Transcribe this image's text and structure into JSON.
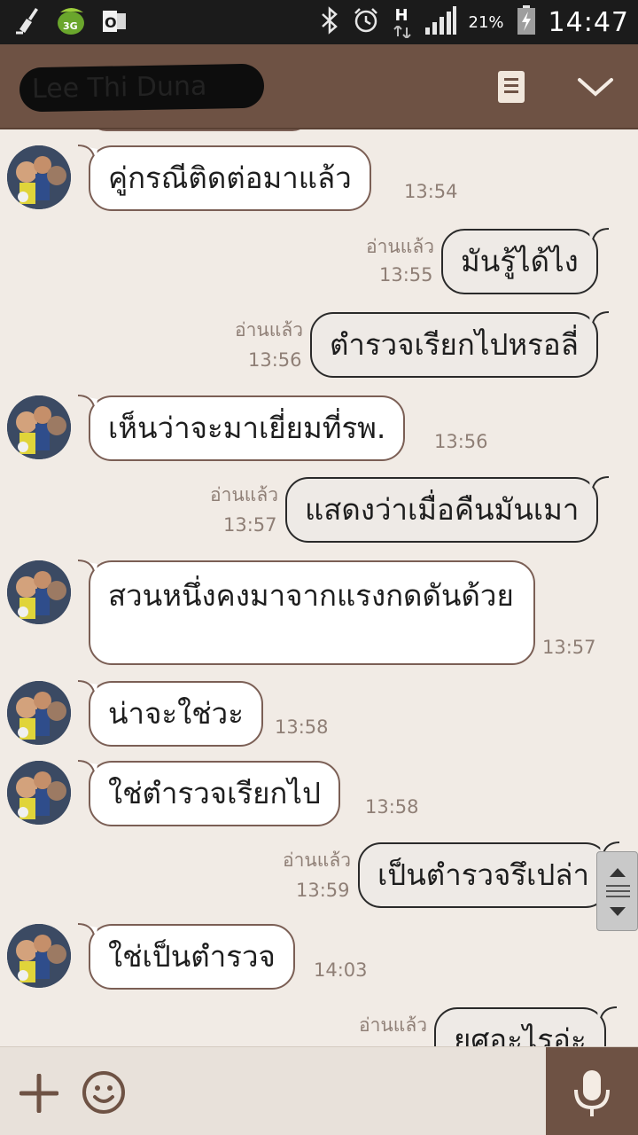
{
  "status_bar": {
    "battery_text": "21%",
    "clock": "14:47",
    "network_label": "H",
    "icons": [
      "broom-icon",
      "3g-leaf-icon",
      "outlook-icon",
      "bluetooth-icon",
      "alarm-icon",
      "signal-icon",
      "battery-icon"
    ]
  },
  "header": {
    "title": "Lee Thi Duna",
    "icons": [
      "memo-icon",
      "chevron-down-icon"
    ],
    "color": "#6e5244"
  },
  "messages": [
    {
      "dir": "in",
      "text": "คู่กรณีติดต่อมาแล้ว",
      "time": "13:54"
    },
    {
      "dir": "out",
      "text": "มันรู้ได้ไง",
      "read": "อ่านแล้ว",
      "time": "13:55"
    },
    {
      "dir": "out",
      "text": "ตำรวจเรียกไปหรอลี่",
      "read": "อ่านแล้ว",
      "time": "13:56"
    },
    {
      "dir": "in",
      "text": "เห็นว่าจะมาเยี่ยมที่รพ.",
      "time": "13:56"
    },
    {
      "dir": "out",
      "text": "แสดงว่าเมื่อคืนมันเมา",
      "read": "อ่านแล้ว",
      "time": "13:57"
    },
    {
      "dir": "in",
      "text": "สวนหนึ่งคงมาจากแรงกดดันด้วย",
      "time": "13:57"
    },
    {
      "dir": "in",
      "text": "น่าจะใช่วะ",
      "time": "13:58"
    },
    {
      "dir": "in",
      "text": "ใช่ตำรวจเรียกไป",
      "time": "13:58"
    },
    {
      "dir": "out",
      "text": "เป็นตำรวจรึเปล่า",
      "read": "อ่านแล้ว",
      "time": "13:59"
    },
    {
      "dir": "in",
      "text": "ใช่เป็นตำรวจ",
      "time": "14:03"
    },
    {
      "dir": "out",
      "text": "ยศอะไรอ่ะ",
      "read": "อ่านแล้ว",
      "time": ""
    }
  ],
  "bottom_bar": {
    "icons": [
      "plus-icon",
      "smiley-icon",
      "microphone-icon"
    ]
  },
  "colors": {
    "background": "#f1ebe5",
    "incoming_bubble": "#ffffff",
    "outgoing_bubble": "#eeeae6",
    "timestamp": "#8f7f76"
  }
}
